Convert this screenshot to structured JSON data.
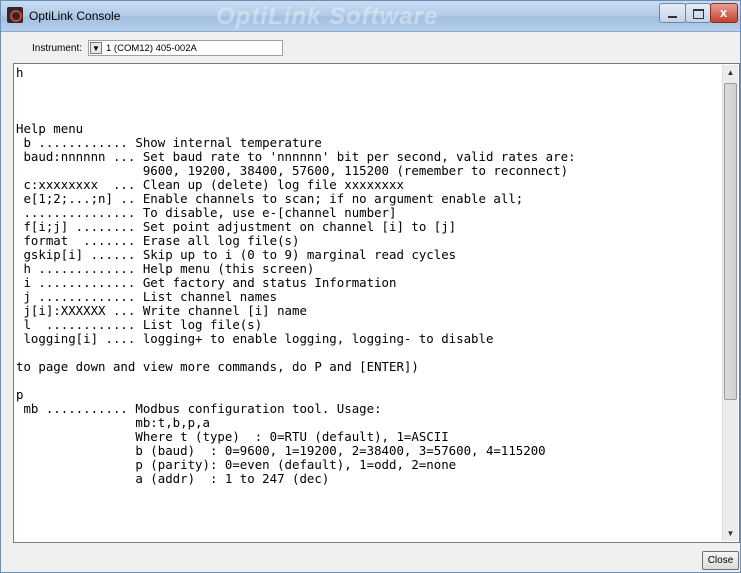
{
  "window": {
    "title": "OptiLink Console",
    "watermark": "OptiLink Software",
    "buttons": {
      "minimize": "minimize",
      "maximize": "maximize",
      "close_glyph": "x"
    }
  },
  "instrument": {
    "label": "Instrument:",
    "selected": "1 (COM12)  405-002A"
  },
  "console": {
    "text": "h\n\n\n\nHelp menu\n b ............ Show internal temperature\n baud:nnnnnn ... Set baud rate to 'nnnnnn' bit per second, valid rates are:\n                 9600, 19200, 38400, 57600, 115200 (remember to reconnect)\n c:xxxxxxxx  ... Clean up (delete) log file xxxxxxxx\n e[1;2;...;n] .. Enable channels to scan; if no argument enable all;\n ............... To disable, use e-[channel number]\n f[i;j] ........ Set point adjustment on channel [i] to [j]\n format  ....... Erase all log file(s)\n gskip[i] ...... Skip up to i (0 to 9) marginal read cycles\n h ............. Help menu (this screen)\n i ............. Get factory and status Information\n j ............. List channel names\n j[i]:XXXXXX ... Write channel [i] name\n l  ............ List log file(s)\n logging[i] .... logging+ to enable logging, logging- to disable\n\nto page down and view more commands, do P and [ENTER])\n\np\n mb ........... Modbus configuration tool. Usage:\n                mb:t,b,p,a\n                Where t (type)  : 0=RTU (default), 1=ASCII\n                b (baud)  : 0=9600, 1=19200, 2=38400, 3=57600, 4=115200\n                p (parity): 0=even (default), 1=odd, 2=none\n                a (addr)  : 1 to 247 (dec)"
  },
  "footer": {
    "close_label": "Close"
  },
  "icons": {
    "app": "optilink-app-icon",
    "scroll_up": "scroll-up-icon",
    "scroll_down": "scroll-down-icon"
  }
}
